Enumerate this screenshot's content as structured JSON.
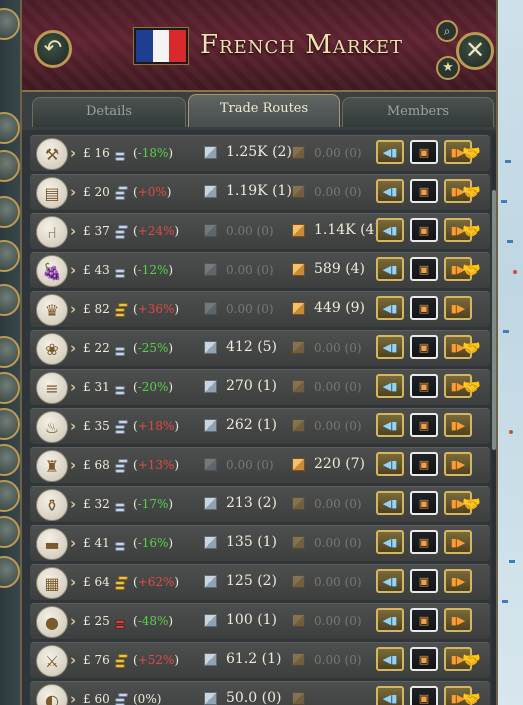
{
  "header": {
    "title": "French Market",
    "back_icon": "↶",
    "close_icon": "✕",
    "search_icon": "⌕",
    "star_icon": "★",
    "flag_colors": [
      "#1e3f8f",
      "#f4f4f4",
      "#d82a2a"
    ]
  },
  "tabs": [
    {
      "label": "Details",
      "active": false
    },
    {
      "label": "Trade Routes",
      "active": true
    },
    {
      "label": "Members",
      "active": false
    }
  ],
  "colors": {
    "positive": "#5bcf49",
    "negative": "#e04a43",
    "neutral": "#f0ead8"
  },
  "rows": [
    {
      "icon": "tools-icon",
      "glyph": "⚒",
      "price": "£ 16",
      "coin": "silver",
      "pct": "-18%",
      "pct_sign": "positive",
      "export": "1.25K",
      "export_routes": "(2)",
      "export_active": true,
      "import": "0.00",
      "import_routes": "(0)",
      "import_active": false,
      "handshake": true
    },
    {
      "icon": "wood-icon",
      "glyph": "▤",
      "price": "£ 20",
      "coin": "silver-stack",
      "pct": "+0%",
      "pct_sign": "negative",
      "export": "1.19K",
      "export_routes": "(1)",
      "export_active": true,
      "import": "0.00",
      "import_routes": "(0)",
      "import_active": false,
      "handshake": true
    },
    {
      "icon": "furniture-icon",
      "glyph": "⑁",
      "price": "£ 37",
      "coin": "silver-stack",
      "pct": "+24%",
      "pct_sign": "negative",
      "export": "0.00",
      "export_routes": "(0)",
      "export_active": false,
      "import": "1.14K",
      "import_routes": "(4)",
      "import_active": true,
      "handshake": true
    },
    {
      "icon": "wine-icon",
      "glyph": "🍇",
      "price": "£ 43",
      "coin": "silver",
      "pct": "-12%",
      "pct_sign": "positive",
      "export": "0.00",
      "export_routes": "(0)",
      "export_active": false,
      "import": "589",
      "import_routes": "(4)",
      "import_active": true,
      "handshake": true
    },
    {
      "icon": "luxury-furniture-icon",
      "glyph": "♛",
      "price": "£ 82",
      "coin": "gold",
      "pct": "+36%",
      "pct_sign": "negative",
      "export": "0.00",
      "export_routes": "(0)",
      "export_active": false,
      "import": "449",
      "import_routes": "(9)",
      "import_active": true,
      "handshake": false
    },
    {
      "icon": "grain-icon",
      "glyph": "❀",
      "price": "£ 22",
      "coin": "silver",
      "pct": "-25%",
      "pct_sign": "positive",
      "export": "412",
      "export_routes": "(5)",
      "export_active": true,
      "import": "0.00",
      "import_routes": "(0)",
      "import_active": false,
      "handshake": true
    },
    {
      "icon": "lumber-icon",
      "glyph": "≡",
      "price": "£ 31",
      "coin": "silver",
      "pct": "-20%",
      "pct_sign": "positive",
      "export": "270",
      "export_routes": "(1)",
      "export_active": true,
      "import": "0.00",
      "import_routes": "(0)",
      "import_active": false,
      "handshake": true
    },
    {
      "icon": "liquor-icon",
      "glyph": "♨",
      "price": "£ 35",
      "coin": "silver-stack",
      "pct": "+18%",
      "pct_sign": "negative",
      "export": "262",
      "export_routes": "(1)",
      "export_active": true,
      "import": "0.00",
      "import_routes": "(0)",
      "import_active": false,
      "handshake": false
    },
    {
      "icon": "clothes-icon",
      "glyph": "♜",
      "price": "£ 68",
      "coin": "silver-stack",
      "pct": "+13%",
      "pct_sign": "negative",
      "export": "0.00",
      "export_routes": "(0)",
      "export_active": false,
      "import": "220",
      "import_routes": "(7)",
      "import_active": true,
      "handshake": false
    },
    {
      "icon": "glass-icon",
      "glyph": "⚱",
      "price": "£ 32",
      "coin": "silver",
      "pct": "-17%",
      "pct_sign": "positive",
      "export": "213",
      "export_routes": "(2)",
      "export_active": true,
      "import": "0.00",
      "import_routes": "(0)",
      "import_active": false,
      "handshake": true
    },
    {
      "icon": "steel-icon",
      "glyph": "▬",
      "price": "£ 41",
      "coin": "silver",
      "pct": "-16%",
      "pct_sign": "positive",
      "export": "135",
      "export_routes": "(1)",
      "export_active": true,
      "import": "0.00",
      "import_routes": "(0)",
      "import_active": false,
      "handshake": false
    },
    {
      "icon": "paper-icon",
      "glyph": "▦",
      "price": "£ 64",
      "coin": "gold",
      "pct": "+62%",
      "pct_sign": "negative",
      "export": "125",
      "export_routes": "(2)",
      "export_active": true,
      "import": "0.00",
      "import_routes": "(0)",
      "import_active": false,
      "handshake": false
    },
    {
      "icon": "fruit-icon",
      "glyph": "●",
      "price": "£ 25",
      "coin": "red",
      "pct": "-48%",
      "pct_sign": "positive",
      "export": "100",
      "export_routes": "(1)",
      "export_active": true,
      "import": "0.00",
      "import_routes": "(0)",
      "import_active": false,
      "handshake": false
    },
    {
      "icon": "small-arms-icon",
      "glyph": "⚔",
      "price": "£ 76",
      "coin": "gold",
      "pct": "+52%",
      "pct_sign": "negative",
      "export": "61.2",
      "export_routes": "(1)",
      "export_active": true,
      "import": "0.00",
      "import_routes": "(0)",
      "import_active": false,
      "handshake": true
    },
    {
      "icon": "meat-icon",
      "glyph": "◐",
      "price": "£ 60",
      "coin": "silver-stack",
      "pct": "(0%)",
      "pct_sign": "neutral",
      "export": "50.0",
      "export_routes": "(0)",
      "export_active": true,
      "import": "",
      "import_routes": "",
      "import_active": false,
      "handshake": true
    }
  ]
}
